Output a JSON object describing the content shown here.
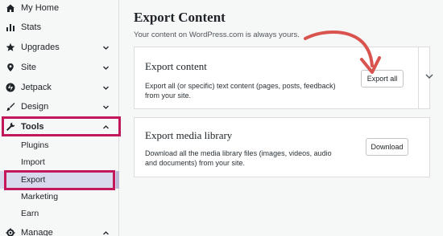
{
  "sidebar": {
    "items": [
      {
        "label": "My Home",
        "icon": "home-icon"
      },
      {
        "label": "Stats",
        "icon": "stats-icon"
      },
      {
        "label": "Upgrades",
        "icon": "star-icon"
      },
      {
        "label": "Site",
        "icon": "location-icon"
      },
      {
        "label": "Jetpack",
        "icon": "jetpack-icon"
      },
      {
        "label": "Design",
        "icon": "brush-icon"
      },
      {
        "label": "Tools",
        "icon": "wrench-icon"
      }
    ],
    "tools_subitems": [
      "Plugins",
      "Import",
      "Export",
      "Marketing",
      "Earn"
    ],
    "manage": {
      "label": "Manage",
      "icon": "gear-icon"
    }
  },
  "main": {
    "title": "Export Content",
    "subtitle": "Your content on WordPress.com is always yours.",
    "export_card": {
      "heading": "Export content",
      "description": "Export all (or specific) text content (pages, posts, feedback) from your site.",
      "button": "Export all"
    },
    "media_card": {
      "heading": "Export media library",
      "description": "Download all the media library files (images, videos, audio and documents) from your site.",
      "button": "Download"
    }
  },
  "colors": {
    "highlight": "#c2185b",
    "arrow": "#d9534f",
    "active_bg": "#d9d9ee"
  }
}
